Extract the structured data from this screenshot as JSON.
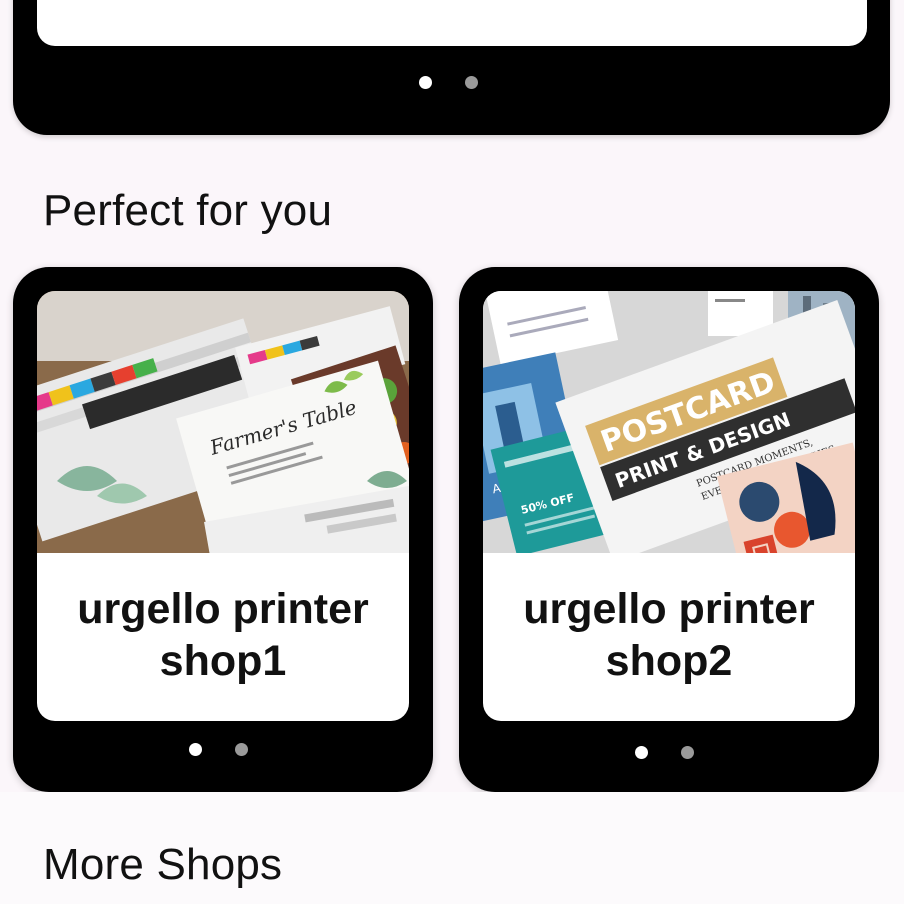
{
  "sections": {
    "perfect_for_you": "Perfect for you",
    "more_shops": "More Shops"
  },
  "shops": [
    {
      "name": "urgello printer shop1",
      "image_text": "Farmer's Table"
    },
    {
      "name": "urgello printer shop2",
      "image_text": {
        "line1": "POSTCARD",
        "line2": "PRINT & DESIGN",
        "tagline1": "POSTCARD MOMENTS,",
        "tagline2": "EVERLASTING MEMORIES.",
        "offer": "50% OFF"
      }
    }
  ],
  "carousel": {
    "pages": 2,
    "active": 0
  }
}
